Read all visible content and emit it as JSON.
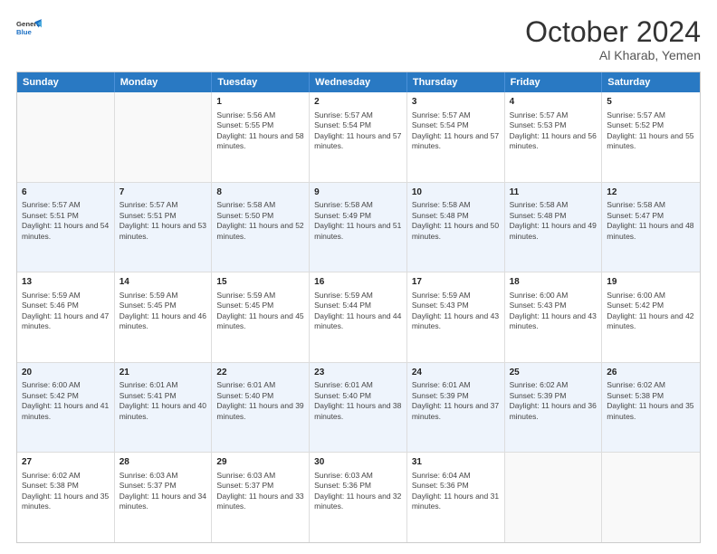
{
  "header": {
    "logo_line1": "General",
    "logo_line2": "Blue",
    "month": "October 2024",
    "location": "Al Kharab, Yemen"
  },
  "weekdays": [
    "Sunday",
    "Monday",
    "Tuesday",
    "Wednesday",
    "Thursday",
    "Friday",
    "Saturday"
  ],
  "rows": [
    [
      {
        "day": "",
        "info": ""
      },
      {
        "day": "",
        "info": ""
      },
      {
        "day": "1",
        "info": "Sunrise: 5:56 AM\nSunset: 5:55 PM\nDaylight: 11 hours and 58 minutes."
      },
      {
        "day": "2",
        "info": "Sunrise: 5:57 AM\nSunset: 5:54 PM\nDaylight: 11 hours and 57 minutes."
      },
      {
        "day": "3",
        "info": "Sunrise: 5:57 AM\nSunset: 5:54 PM\nDaylight: 11 hours and 57 minutes."
      },
      {
        "day": "4",
        "info": "Sunrise: 5:57 AM\nSunset: 5:53 PM\nDaylight: 11 hours and 56 minutes."
      },
      {
        "day": "5",
        "info": "Sunrise: 5:57 AM\nSunset: 5:52 PM\nDaylight: 11 hours and 55 minutes."
      }
    ],
    [
      {
        "day": "6",
        "info": "Sunrise: 5:57 AM\nSunset: 5:51 PM\nDaylight: 11 hours and 54 minutes."
      },
      {
        "day": "7",
        "info": "Sunrise: 5:57 AM\nSunset: 5:51 PM\nDaylight: 11 hours and 53 minutes."
      },
      {
        "day": "8",
        "info": "Sunrise: 5:58 AM\nSunset: 5:50 PM\nDaylight: 11 hours and 52 minutes."
      },
      {
        "day": "9",
        "info": "Sunrise: 5:58 AM\nSunset: 5:49 PM\nDaylight: 11 hours and 51 minutes."
      },
      {
        "day": "10",
        "info": "Sunrise: 5:58 AM\nSunset: 5:48 PM\nDaylight: 11 hours and 50 minutes."
      },
      {
        "day": "11",
        "info": "Sunrise: 5:58 AM\nSunset: 5:48 PM\nDaylight: 11 hours and 49 minutes."
      },
      {
        "day": "12",
        "info": "Sunrise: 5:58 AM\nSunset: 5:47 PM\nDaylight: 11 hours and 48 minutes."
      }
    ],
    [
      {
        "day": "13",
        "info": "Sunrise: 5:59 AM\nSunset: 5:46 PM\nDaylight: 11 hours and 47 minutes."
      },
      {
        "day": "14",
        "info": "Sunrise: 5:59 AM\nSunset: 5:45 PM\nDaylight: 11 hours and 46 minutes."
      },
      {
        "day": "15",
        "info": "Sunrise: 5:59 AM\nSunset: 5:45 PM\nDaylight: 11 hours and 45 minutes."
      },
      {
        "day": "16",
        "info": "Sunrise: 5:59 AM\nSunset: 5:44 PM\nDaylight: 11 hours and 44 minutes."
      },
      {
        "day": "17",
        "info": "Sunrise: 5:59 AM\nSunset: 5:43 PM\nDaylight: 11 hours and 43 minutes."
      },
      {
        "day": "18",
        "info": "Sunrise: 6:00 AM\nSunset: 5:43 PM\nDaylight: 11 hours and 43 minutes."
      },
      {
        "day": "19",
        "info": "Sunrise: 6:00 AM\nSunset: 5:42 PM\nDaylight: 11 hours and 42 minutes."
      }
    ],
    [
      {
        "day": "20",
        "info": "Sunrise: 6:00 AM\nSunset: 5:42 PM\nDaylight: 11 hours and 41 minutes."
      },
      {
        "day": "21",
        "info": "Sunrise: 6:01 AM\nSunset: 5:41 PM\nDaylight: 11 hours and 40 minutes."
      },
      {
        "day": "22",
        "info": "Sunrise: 6:01 AM\nSunset: 5:40 PM\nDaylight: 11 hours and 39 minutes."
      },
      {
        "day": "23",
        "info": "Sunrise: 6:01 AM\nSunset: 5:40 PM\nDaylight: 11 hours and 38 minutes."
      },
      {
        "day": "24",
        "info": "Sunrise: 6:01 AM\nSunset: 5:39 PM\nDaylight: 11 hours and 37 minutes."
      },
      {
        "day": "25",
        "info": "Sunrise: 6:02 AM\nSunset: 5:39 PM\nDaylight: 11 hours and 36 minutes."
      },
      {
        "day": "26",
        "info": "Sunrise: 6:02 AM\nSunset: 5:38 PM\nDaylight: 11 hours and 35 minutes."
      }
    ],
    [
      {
        "day": "27",
        "info": "Sunrise: 6:02 AM\nSunset: 5:38 PM\nDaylight: 11 hours and 35 minutes."
      },
      {
        "day": "28",
        "info": "Sunrise: 6:03 AM\nSunset: 5:37 PM\nDaylight: 11 hours and 34 minutes."
      },
      {
        "day": "29",
        "info": "Sunrise: 6:03 AM\nSunset: 5:37 PM\nDaylight: 11 hours and 33 minutes."
      },
      {
        "day": "30",
        "info": "Sunrise: 6:03 AM\nSunset: 5:36 PM\nDaylight: 11 hours and 32 minutes."
      },
      {
        "day": "31",
        "info": "Sunrise: 6:04 AM\nSunset: 5:36 PM\nDaylight: 11 hours and 31 minutes."
      },
      {
        "day": "",
        "info": ""
      },
      {
        "day": "",
        "info": ""
      }
    ]
  ]
}
